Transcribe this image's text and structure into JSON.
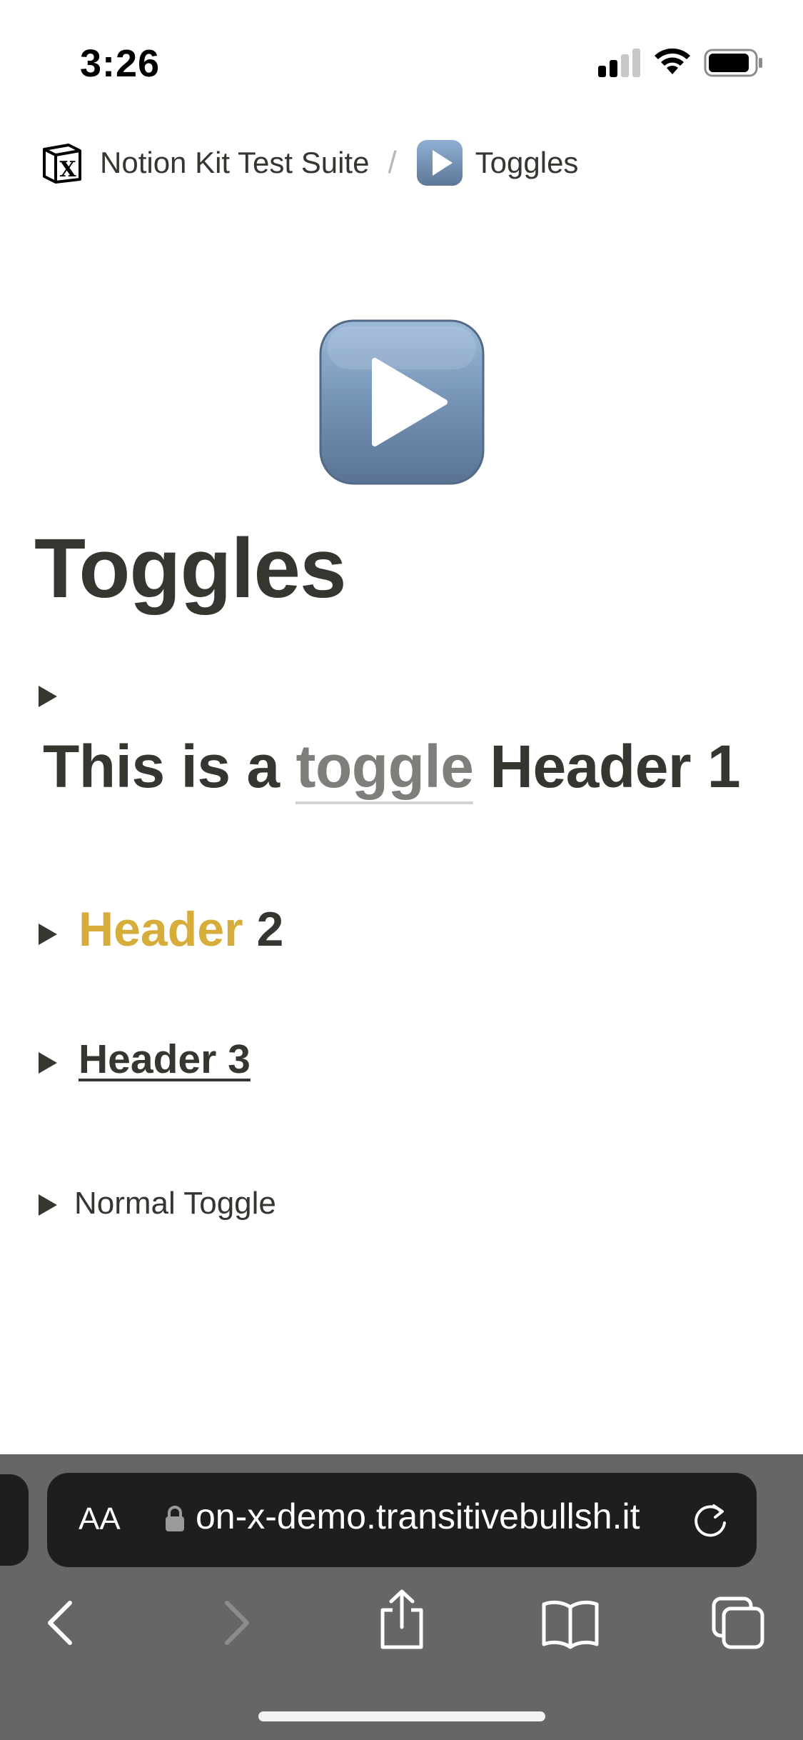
{
  "status_bar": {
    "time": "3:26"
  },
  "breadcrumb": {
    "workspace_label": "Notion Kit Test Suite",
    "separator": "/",
    "page_label": "Toggles"
  },
  "page": {
    "title": "Toggles"
  },
  "toggles": [
    {
      "type": "header_1",
      "parts": [
        "This is a",
        "toggle",
        "Header 1"
      ]
    },
    {
      "type": "header_2",
      "parts": [
        "Header",
        "2"
      ],
      "accent_color": "#d6ad3b"
    },
    {
      "type": "header_3",
      "parts": [
        "Header 3"
      ]
    },
    {
      "type": "normal",
      "parts": [
        "Normal Toggle"
      ]
    }
  ],
  "browser": {
    "text_size_button": "AA",
    "url": "on-x-demo.transitivebullsh.it"
  },
  "colors": {
    "text": "#37352f",
    "link_muted": "#7f7e7a",
    "yellow": "#d6ad3b",
    "toolbar_bg": "#666666",
    "url_bar_bg": "#1e1e1e"
  },
  "icons": [
    "notion-logo-icon",
    "play-button-icon",
    "toggle-arrow-icon",
    "lock-icon",
    "reload-icon",
    "back-icon",
    "forward-icon",
    "share-icon",
    "bookmarks-icon",
    "tabs-icon"
  ]
}
